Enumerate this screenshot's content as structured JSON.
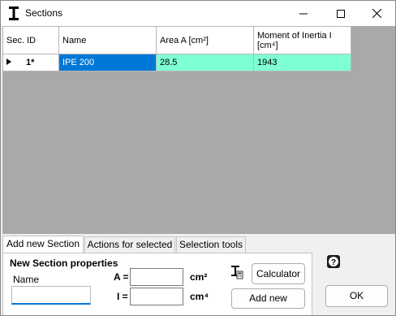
{
  "window": {
    "title": "Sections"
  },
  "grid": {
    "headers": {
      "sec_id": "Sec. ID",
      "name": "Name",
      "area": "Area A [cm²]",
      "moi_line1": "Moment of Inertia I",
      "moi_line2": "[cm⁴]"
    },
    "rows": [
      {
        "sec_id": "1*",
        "name": "IPE 200",
        "area": "28.5",
        "moi": "1943"
      }
    ]
  },
  "tabs": {
    "add_new": "Add new Section",
    "actions": "Actions for selected",
    "selection": "Selection tools"
  },
  "form": {
    "section_title": "New Section properties",
    "name_label": "Name",
    "name_value": "",
    "area_label": "A =",
    "area_value": "",
    "area_unit": "cm²",
    "inertia_label": "I =",
    "inertia_value": "",
    "inertia_unit": "cm⁴",
    "calculator_label": "Calculator",
    "add_new_label": "Add new"
  },
  "ok_label": "OK"
}
